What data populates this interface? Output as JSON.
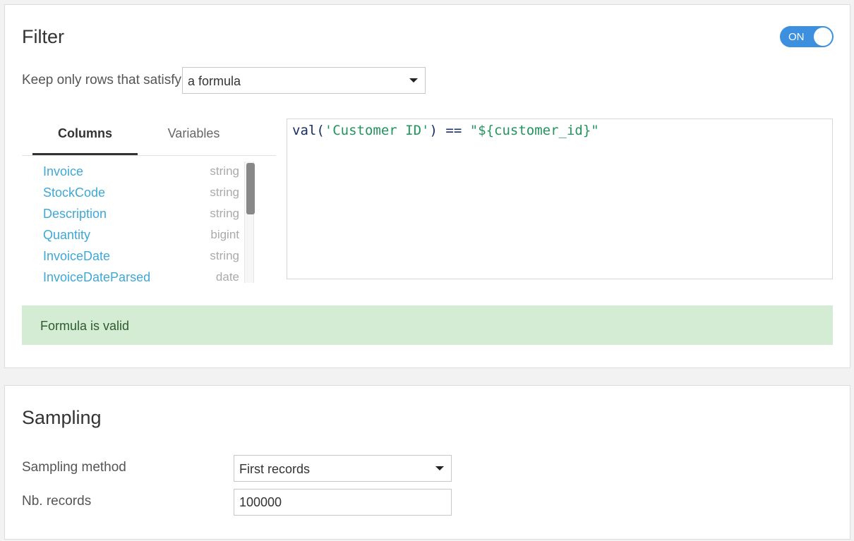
{
  "filter": {
    "title": "Filter",
    "toggle_label": "ON",
    "keep_label": "Keep only rows that satisfy",
    "mode_select": "a formula",
    "tabs": [
      {
        "label": "Columns",
        "active": true
      },
      {
        "label": "Variables",
        "active": false
      }
    ],
    "columns": [
      {
        "name": "Invoice",
        "type": "string"
      },
      {
        "name": "StockCode",
        "type": "string"
      },
      {
        "name": "Description",
        "type": "string"
      },
      {
        "name": "Quantity",
        "type": "bigint"
      },
      {
        "name": "InvoiceDate",
        "type": "string"
      },
      {
        "name": "InvoiceDateParsed",
        "type": "date"
      }
    ],
    "formula": {
      "fn": "val(",
      "arg": "'Customer ID'",
      "close": ") ",
      "op": "==",
      "space": " ",
      "value": "\"${customer_id}\""
    },
    "validation_message": "Formula is valid"
  },
  "sampling": {
    "title": "Sampling",
    "method_label": "Sampling method",
    "method_value": "First records",
    "nb_records_label": "Nb. records",
    "nb_records_value": "100000"
  },
  "colors": {
    "toggle_on": "#3d8fe0",
    "column_name": "#3ea8d6",
    "valid_bg": "#d5ecd4"
  }
}
